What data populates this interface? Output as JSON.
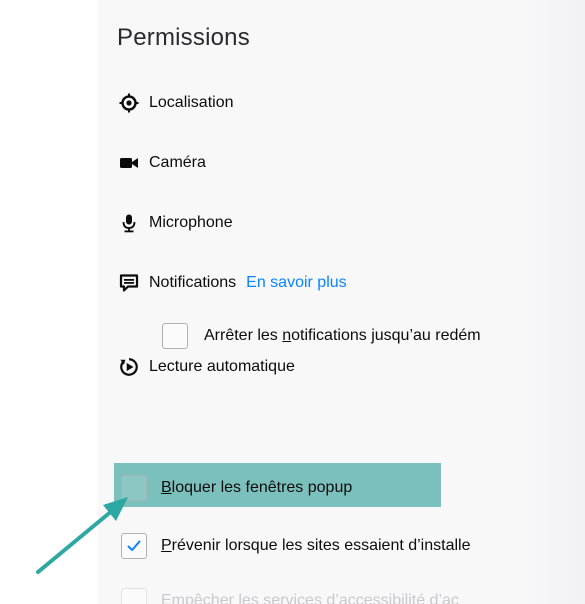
{
  "section": {
    "title": "Permissions"
  },
  "permissions": {
    "location": {
      "label": "Localisation",
      "icon": "location-icon"
    },
    "camera": {
      "label": "Caméra",
      "icon": "camera-icon"
    },
    "microphone": {
      "label": "Microphone",
      "icon": "microphone-icon"
    },
    "notifications": {
      "label": "Notifications",
      "learn_more": "En savoir plus",
      "icon": "notification-icon"
    },
    "pause_notifications": {
      "label_prefix": "Arrêter les ",
      "label_accesskey": "n",
      "label_suffix": "otifications jusqu’au redém",
      "checked": false
    },
    "autoplay": {
      "label": "Lecture automatique",
      "icon": "autoplay-icon"
    }
  },
  "popups": {
    "label_accesskey": "B",
    "label_rest": "loquer les fenêtres popup",
    "checked": false
  },
  "addons_warning": {
    "label_accesskey": "P",
    "label_rest": "révenir lorsque les sites essaient d’installe",
    "checked": true
  },
  "accessibility": {
    "label": "Empêcher les services d’accessibilité d’ac"
  },
  "colors": {
    "accent": "#0a84ff",
    "highlight": "#7cc0bd",
    "arrow": "#2ea8a3"
  }
}
